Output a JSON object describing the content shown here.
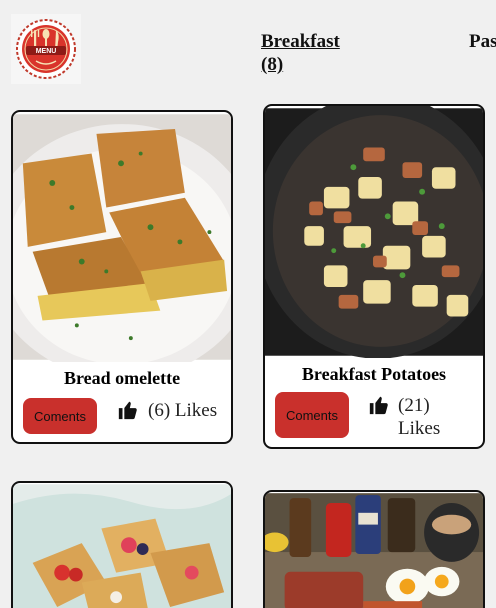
{
  "logo": {
    "text": "MENU"
  },
  "nav": {
    "breakfast": "Breakfast (8)",
    "pasta": "Pasta"
  },
  "cards": [
    {
      "title": "Bread omelette",
      "comments_label": "Coments",
      "likes_count": "(6)",
      "likes_word": "Likes"
    },
    {
      "title": "Breakfast Potatoes",
      "comments_label": "Coments",
      "likes_count": "(21)",
      "likes_word": "Likes"
    }
  ],
  "icons": [
    "menu-logo-icon",
    "thumbs-up-icon"
  ],
  "colors": {
    "button": "#c9302c",
    "page_bg": "#f0f0f0",
    "card_border": "#111111"
  }
}
